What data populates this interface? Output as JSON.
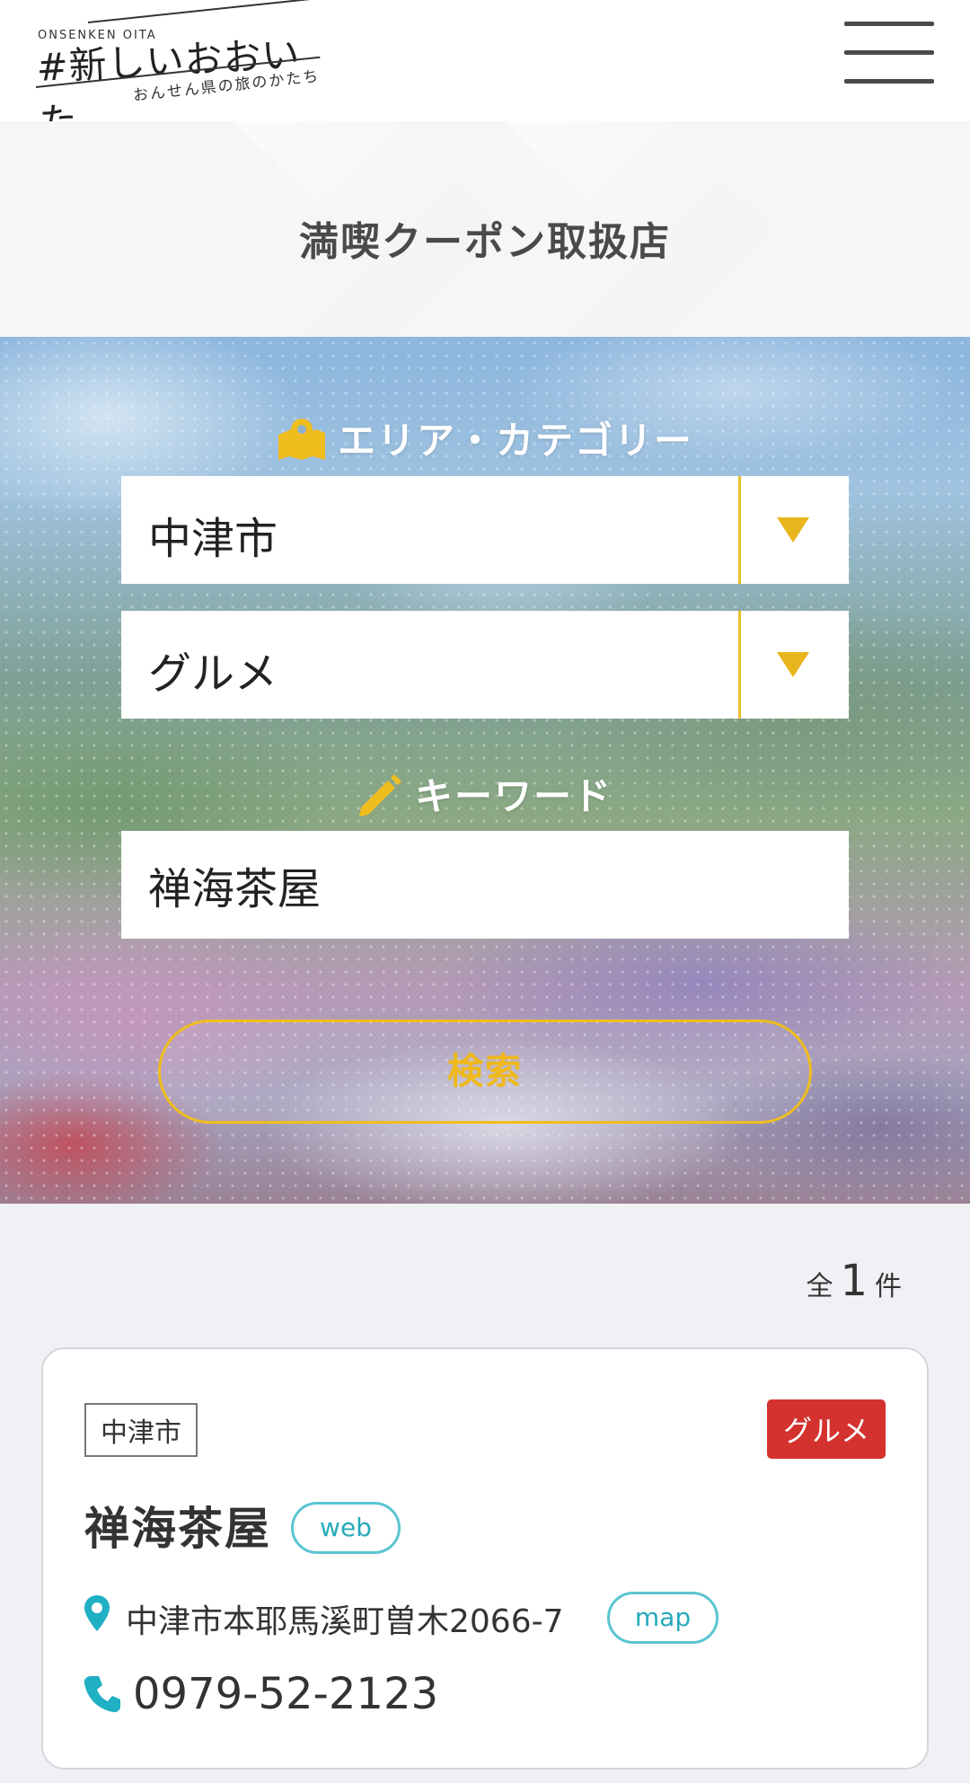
{
  "header": {
    "logo_small": "ONSENKEN OITA",
    "logo_main": "#新しいおおいた",
    "logo_sub": "おんせん県の旅のかたち",
    "menu_icon": "hamburger-menu-icon"
  },
  "page": {
    "title": "満喫クーポン取扱店"
  },
  "search": {
    "area_category_label": "エリア・カテゴリー",
    "area_select_value": "中津市",
    "category_select_value": "グルメ",
    "keyword_label": "キーワード",
    "keyword_value": "禅海茶屋",
    "search_button_label": "検索",
    "accent_color": "#efb81b"
  },
  "results": {
    "count_prefix": "全",
    "count": "1",
    "count_suffix": "件",
    "items": [
      {
        "area": "中津市",
        "category": "グルメ",
        "category_color": "#d4322e",
        "name": "禅海茶屋",
        "web_label": "web",
        "address": "中津市本耶馬溪町曽木2066-7",
        "map_label": "map",
        "tel": "0979-52-2123"
      }
    ]
  }
}
